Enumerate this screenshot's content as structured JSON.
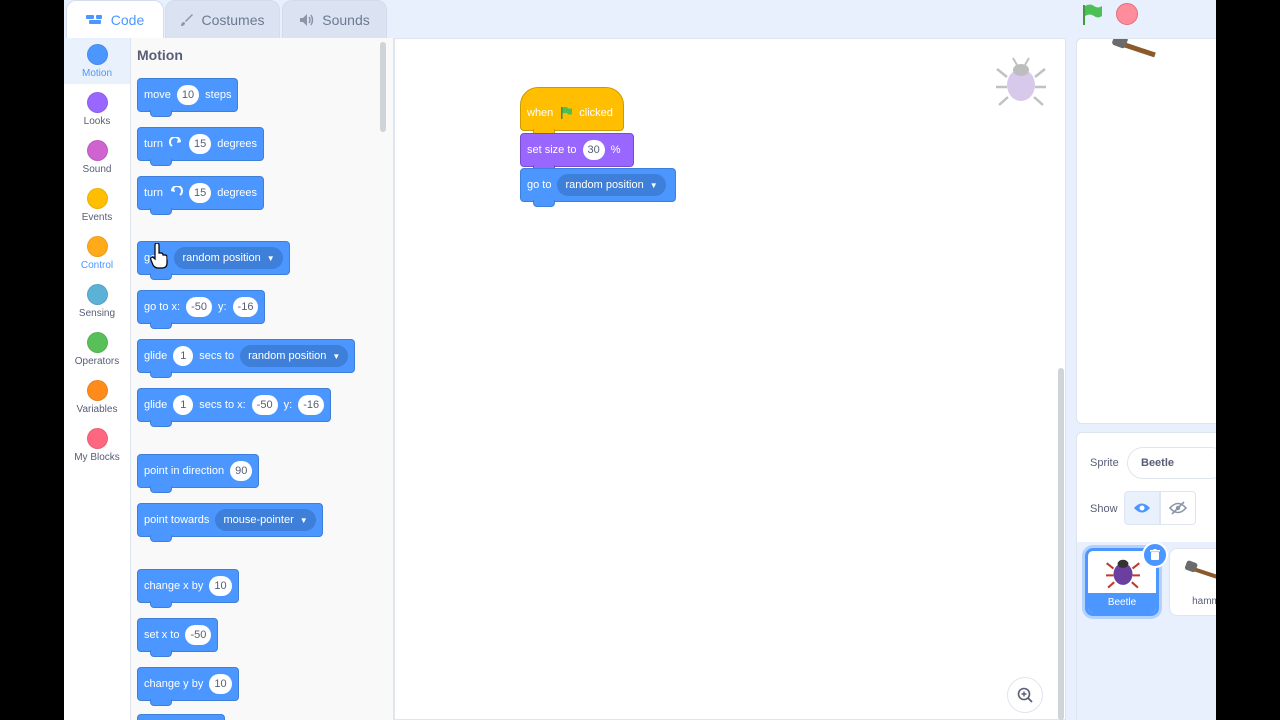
{
  "tabs": [
    {
      "label": "Code",
      "icon": "code-icon"
    },
    {
      "label": "Costumes",
      "icon": "brush-icon"
    },
    {
      "label": "Sounds",
      "icon": "speaker-icon"
    }
  ],
  "categories": [
    {
      "label": "Motion",
      "color": "#4c97ff"
    },
    {
      "label": "Looks",
      "color": "#9966ff"
    },
    {
      "label": "Sound",
      "color": "#cf63cf"
    },
    {
      "label": "Events",
      "color": "#ffbf00"
    },
    {
      "label": "Control",
      "color": "#ffab19"
    },
    {
      "label": "Sensing",
      "color": "#5cb1d6"
    },
    {
      "label": "Operators",
      "color": "#59c059"
    },
    {
      "label": "Variables",
      "color": "#ff8c1a"
    },
    {
      "label": "My Blocks",
      "color": "#ff6680"
    }
  ],
  "palette": {
    "title": "Motion",
    "blocks": {
      "move": {
        "pre": "move",
        "value": "10",
        "post": "steps"
      },
      "turn_right": {
        "pre": "turn",
        "value": "15",
        "post": "degrees"
      },
      "turn_left": {
        "pre": "turn",
        "value": "15",
        "post": "degrees"
      },
      "goto": {
        "pre": "go to",
        "option": "random position"
      },
      "goto_xy": {
        "pre": "go to x:",
        "x": "-50",
        "ylabel": "y:",
        "y": "-16"
      },
      "glide_to": {
        "pre": "glide",
        "value": "1",
        "mid": "secs to",
        "option": "random position"
      },
      "glide_xy": {
        "pre": "glide",
        "value": "1",
        "mid": "secs to x:",
        "x": "-50",
        "ylabel": "y:",
        "y": "-16"
      },
      "point_dir": {
        "pre": "point in direction",
        "value": "90"
      },
      "point_towards": {
        "pre": "point towards",
        "option": "mouse-pointer"
      },
      "change_x": {
        "pre": "change x by",
        "value": "10"
      },
      "set_x": {
        "pre": "set x to",
        "value": "-50"
      },
      "change_y": {
        "pre": "change y by",
        "value": "10"
      }
    }
  },
  "script": {
    "hat": {
      "pre": "when",
      "post": "clicked"
    },
    "set_size": {
      "pre": "set size to",
      "value": "30",
      "post": "%"
    },
    "goto": {
      "pre": "go to",
      "option": "random position"
    }
  },
  "sprite_info": {
    "sprite_label": "Sprite",
    "sprite_name": "Beetle",
    "show_label": "Show"
  },
  "sprites": [
    {
      "name": "Beetle",
      "selected": true
    },
    {
      "name": "hamm"
    }
  ]
}
